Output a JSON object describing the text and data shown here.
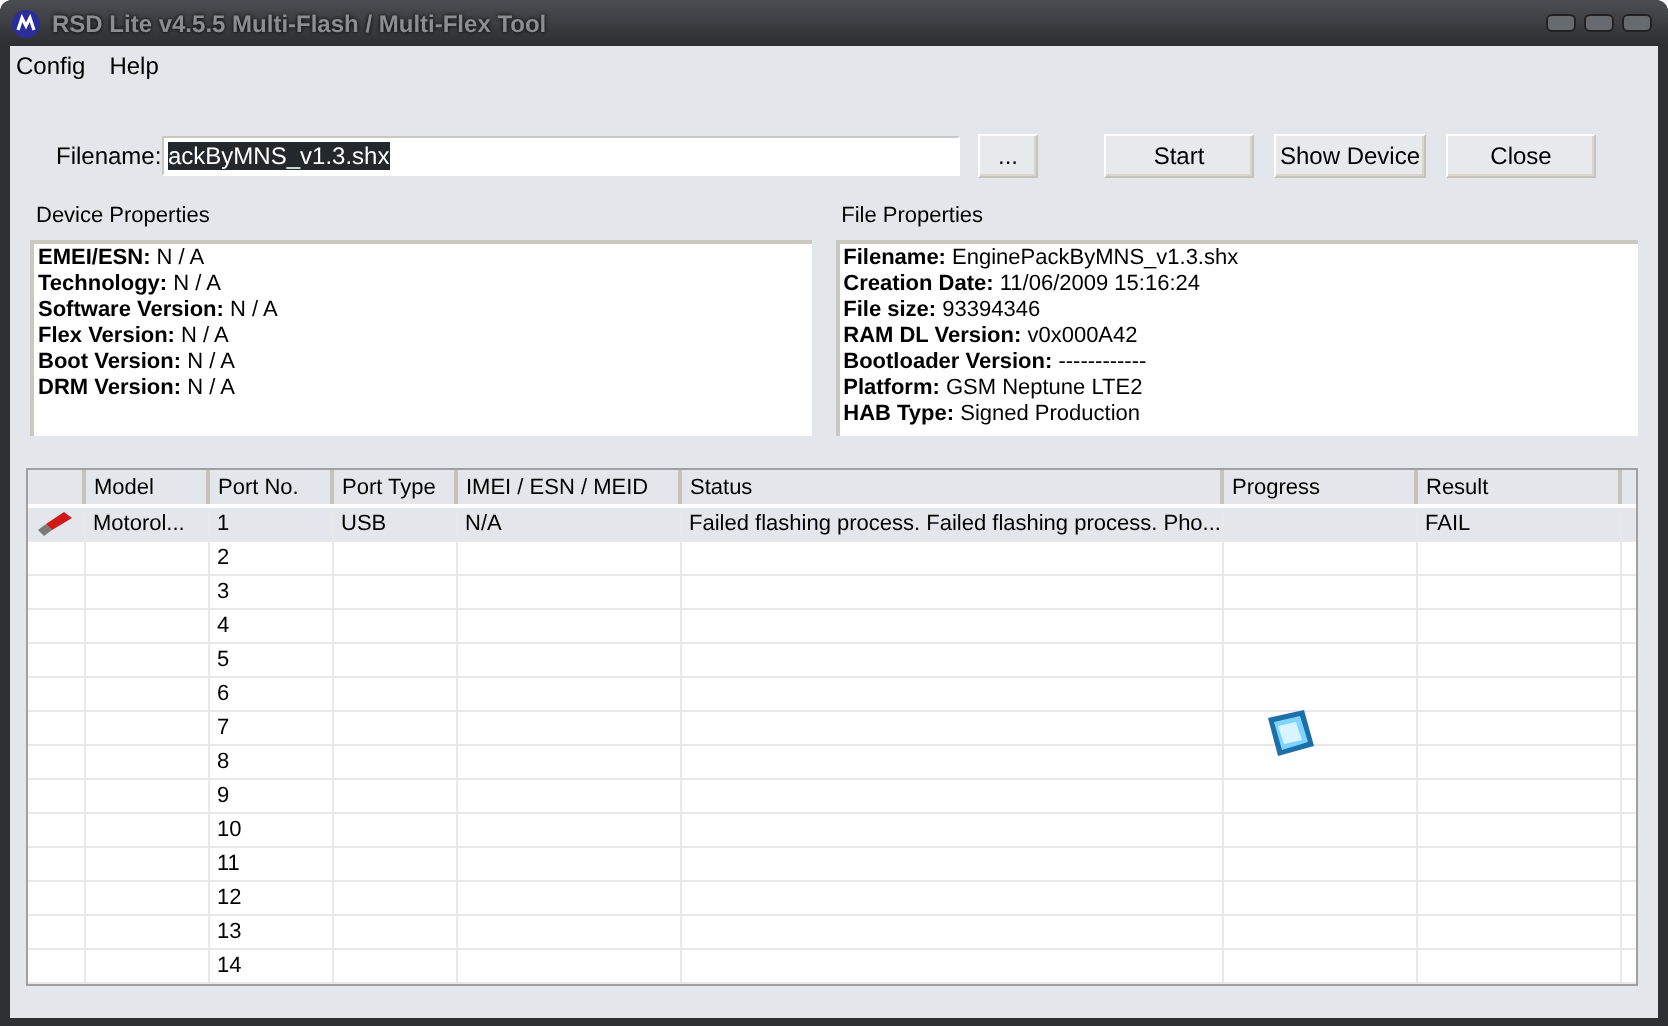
{
  "window": {
    "title": "RSD Lite v4.5.5 Multi-Flash / Multi-Flex Tool"
  },
  "menu": [
    "Config",
    "Help"
  ],
  "filename": {
    "label": "Filename:",
    "value": "ackByMNS_v1.3.shx",
    "browse": "..."
  },
  "buttons": [
    "Start",
    "Show Device",
    "Close"
  ],
  "device_properties": {
    "title": "Device Properties",
    "lines": [
      "**EMEI/ESN:** N / A",
      "**Technology:** N / A",
      "**Software Version:** N / A",
      "**Flex Version:** N / A",
      "**Boot Version:** N / A",
      "**DRM Version:** N / A"
    ]
  },
  "file_properties": {
    "title": "File Properties",
    "lines": [
      "**Filename:** EnginePackByMNS_v1.3.shx",
      "**Creation Date:** 11/06/2009 15:16:24",
      "**File size:** 93394346",
      "**RAM DL Version:** v0x000A42",
      "**Bootloader Version:** ------------",
      "**Platform:** GSM Neptune LTE2",
      "**HAB Type:** Signed Production"
    ]
  },
  "table": {
    "columns": [
      "Model",
      "Port No.",
      "Port Type",
      "IMEI / ESN / MEID",
      "Status",
      "Progress",
      "Result"
    ],
    "rows": [
      {
        "device": true,
        "selected": true,
        "cells": [
          "Motorol...",
          "1",
          "USB",
          "N/A",
          "Failed flashing process. Failed flashing process. Pho...",
          "",
          "FAIL"
        ]
      },
      {
        "device": false,
        "selected": false,
        "cells": [
          "",
          "2",
          "",
          "",
          "",
          "",
          ""
        ]
      },
      {
        "device": false,
        "selected": false,
        "cells": [
          "",
          "3",
          "",
          "",
          "",
          "",
          ""
        ]
      },
      {
        "device": false,
        "selected": false,
        "cells": [
          "",
          "4",
          "",
          "",
          "",
          "",
          ""
        ]
      },
      {
        "device": false,
        "selected": false,
        "cells": [
          "",
          "5",
          "",
          "",
          "",
          "",
          ""
        ]
      },
      {
        "device": false,
        "selected": false,
        "cells": [
          "",
          "6",
          "",
          "",
          "",
          "",
          ""
        ]
      },
      {
        "device": false,
        "selected": false,
        "cells": [
          "",
          "7",
          "",
          "",
          "",
          "",
          ""
        ]
      },
      {
        "device": false,
        "selected": false,
        "cells": [
          "",
          "8",
          "",
          "",
          "",
          "",
          ""
        ]
      },
      {
        "device": false,
        "selected": false,
        "cells": [
          "",
          "9",
          "",
          "",
          "",
          "",
          ""
        ]
      },
      {
        "device": false,
        "selected": false,
        "cells": [
          "",
          "10",
          "",
          "",
          "",
          "",
          ""
        ]
      },
      {
        "device": false,
        "selected": false,
        "cells": [
          "",
          "11",
          "",
          "",
          "",
          "",
          ""
        ]
      },
      {
        "device": false,
        "selected": false,
        "cells": [
          "",
          "12",
          "",
          "",
          "",
          "",
          ""
        ]
      },
      {
        "device": false,
        "selected": false,
        "cells": [
          "",
          "13",
          "",
          "",
          "",
          "",
          ""
        ]
      },
      {
        "device": false,
        "selected": false,
        "cells": [
          "",
          "14",
          "",
          "",
          "",
          "",
          ""
        ]
      }
    ]
  }
}
